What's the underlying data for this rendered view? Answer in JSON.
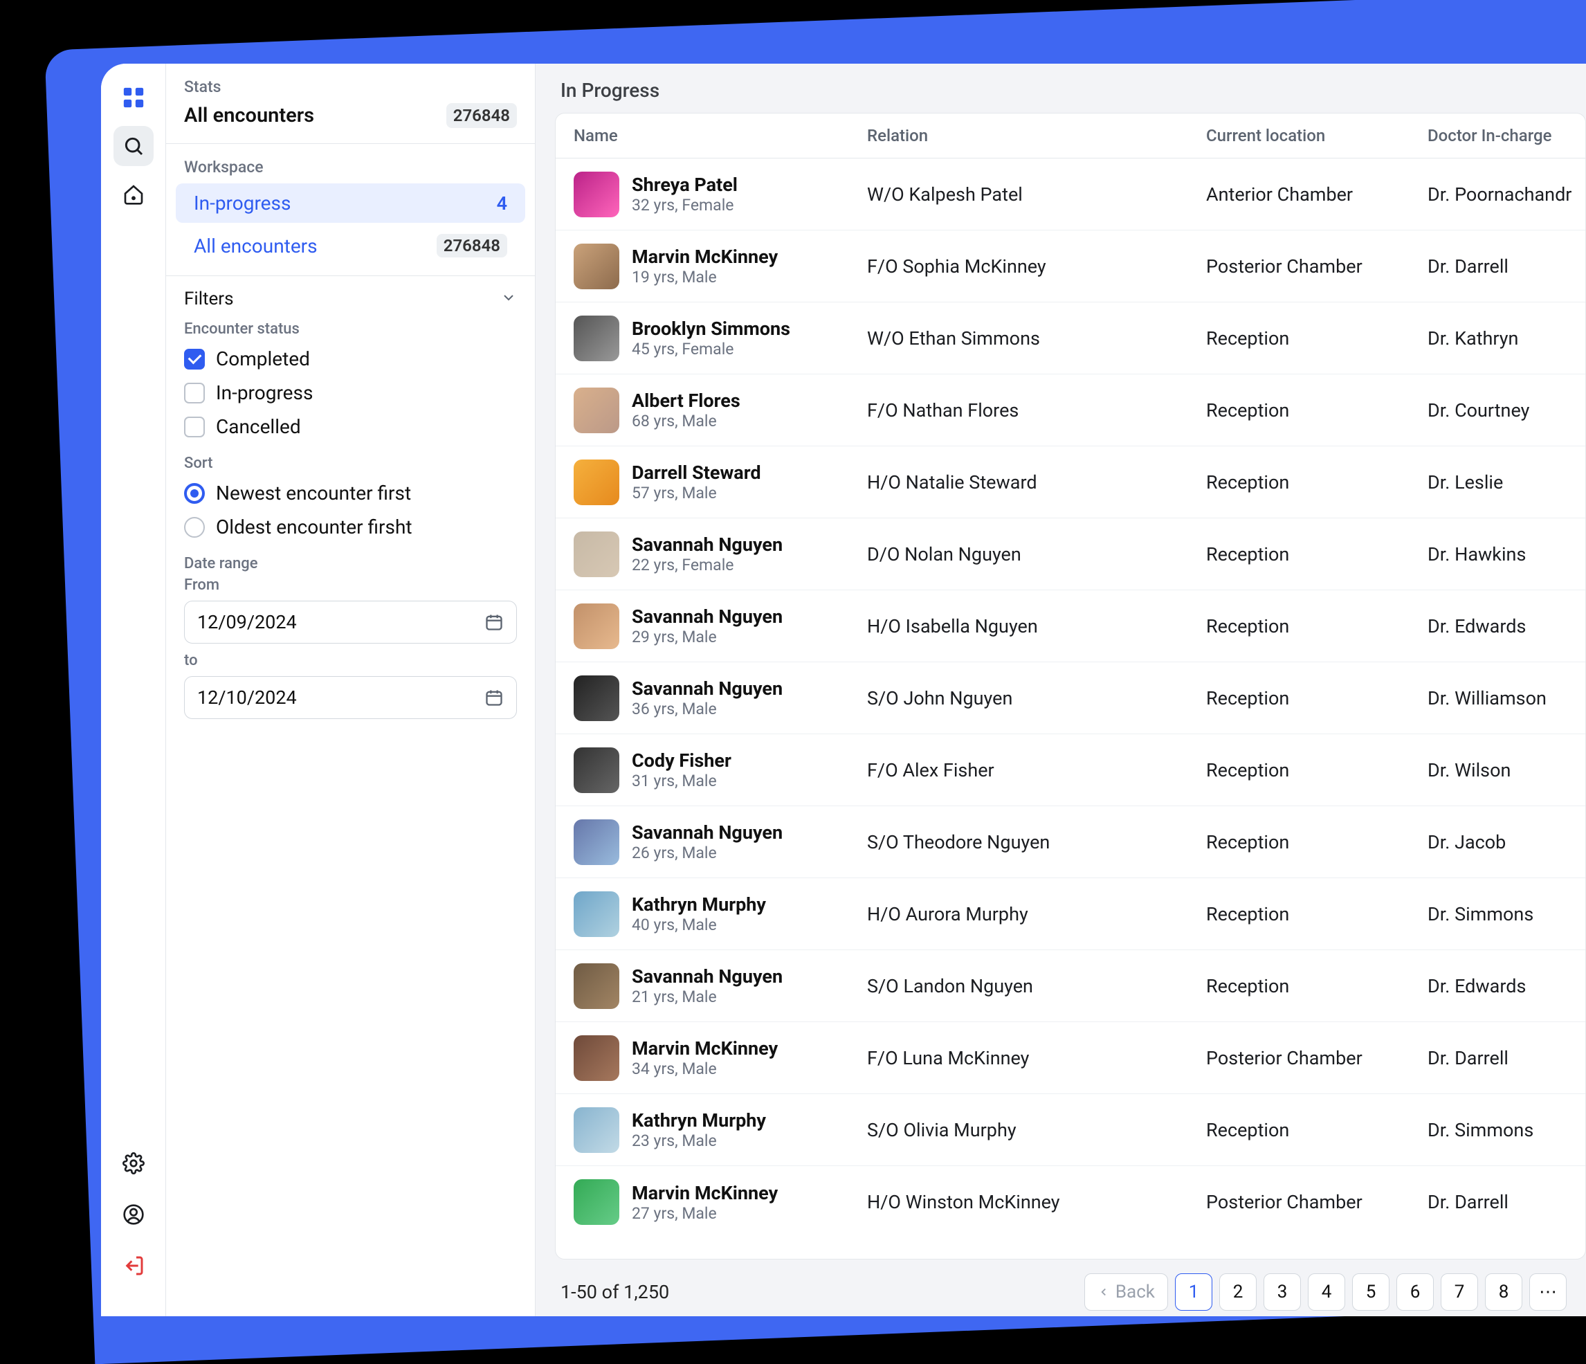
{
  "sidebar": {
    "stats_label": "Stats",
    "stats_title": "All encounters",
    "stats_badge": "276848",
    "workspace_label": "Workspace",
    "ws": [
      {
        "label": "In-progress",
        "count": "4"
      },
      {
        "label": "All encounters",
        "count": "276848"
      }
    ],
    "filters_label": "Filters",
    "status_label": "Encounter status",
    "status_opts": [
      "Completed",
      "In-progress",
      "Cancelled"
    ],
    "sort_label": "Sort",
    "sort_opts": [
      "Newest encounter first",
      "Oldest encounter firsht"
    ],
    "date_range_label": "Date range",
    "from_label": "From",
    "from_value": "12/09/2024",
    "to_label": "to",
    "to_value": "12/10/2024"
  },
  "main": {
    "title": "In Progress",
    "columns": {
      "name": "Name",
      "relation": "Relation",
      "location": "Current location",
      "doctor": "Doctor In-charge"
    },
    "rows": [
      {
        "name": "Shreya Patel",
        "meta": "32 yrs, Female",
        "relation": "W/O Kalpesh Patel",
        "location": "Anterior Chamber",
        "doctor": "Dr. Poornachandr"
      },
      {
        "name": "Marvin McKinney",
        "meta": "19 yrs, Male",
        "relation": "F/O Sophia McKinney",
        "location": "Posterior Chamber",
        "doctor": "Dr. Darrell"
      },
      {
        "name": "Brooklyn Simmons",
        "meta": "45 yrs, Female",
        "relation": "W/O Ethan Simmons",
        "location": "Reception",
        "doctor": "Dr. Kathryn"
      },
      {
        "name": "Albert Flores",
        "meta": "68 yrs, Male",
        "relation": "F/O Nathan Flores",
        "location": "Reception",
        "doctor": "Dr. Courtney"
      },
      {
        "name": "Darrell Steward",
        "meta": "57 yrs, Male",
        "relation": "H/O Natalie Steward",
        "location": "Reception",
        "doctor": "Dr. Leslie"
      },
      {
        "name": "Savannah Nguyen",
        "meta": "22 yrs, Female",
        "relation": "D/O Nolan Nguyen",
        "location": "Reception",
        "doctor": "Dr. Hawkins"
      },
      {
        "name": "Savannah Nguyen",
        "meta": "29 yrs, Male",
        "relation": "H/O Isabella Nguyen",
        "location": "Reception",
        "doctor": "Dr. Edwards"
      },
      {
        "name": "Savannah Nguyen",
        "meta": "36 yrs, Male",
        "relation": "S/O John Nguyen",
        "location": "Reception",
        "doctor": "Dr. Williamson"
      },
      {
        "name": "Cody Fisher",
        "meta": "31 yrs, Male",
        "relation": "F/O Alex Fisher",
        "location": "Reception",
        "doctor": "Dr. Wilson"
      },
      {
        "name": "Savannah Nguyen",
        "meta": "26 yrs, Male",
        "relation": "S/O Theodore Nguyen",
        "location": "Reception",
        "doctor": "Dr. Jacob"
      },
      {
        "name": "Kathryn Murphy",
        "meta": "40 yrs, Male",
        "relation": "H/O Aurora Murphy",
        "location": "Reception",
        "doctor": "Dr. Simmons"
      },
      {
        "name": "Savannah Nguyen",
        "meta": "21 yrs, Male",
        "relation": "S/O Landon Nguyen",
        "location": "Reception",
        "doctor": "Dr. Edwards"
      },
      {
        "name": "Marvin McKinney",
        "meta": "34 yrs, Male",
        "relation": "F/O Luna McKinney",
        "location": "Posterior Chamber",
        "doctor": "Dr. Darrell"
      },
      {
        "name": "Kathryn Murphy",
        "meta": "23 yrs, Male",
        "relation": "S/O Olivia Murphy",
        "location": "Reception",
        "doctor": "Dr. Simmons"
      },
      {
        "name": "Marvin McKinney",
        "meta": "27 yrs, Male",
        "relation": "H/O Winston McKinney",
        "location": "Posterior Chamber",
        "doctor": "Dr. Darrell"
      }
    ],
    "pager_info": "1-50 of 1,250",
    "pager_back": "Back",
    "pages": [
      "1",
      "2",
      "3",
      "4",
      "5",
      "6",
      "7",
      "8"
    ]
  }
}
